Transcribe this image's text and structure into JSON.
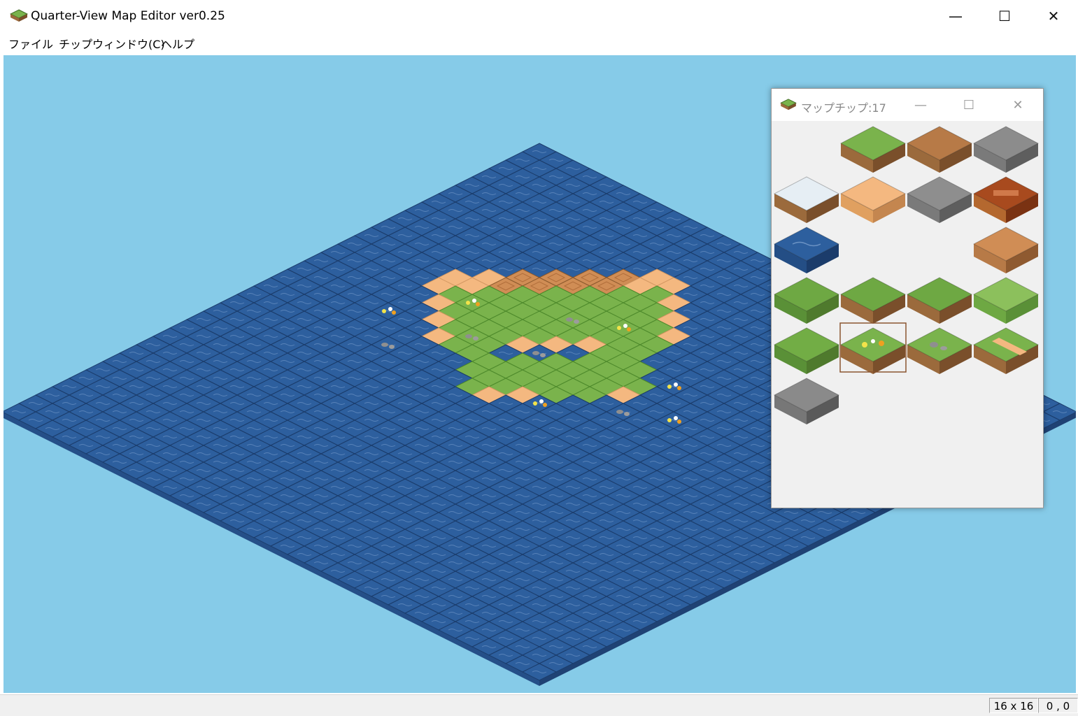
{
  "window": {
    "title": "Quarter-View Map Editor ver0.25",
    "minimize_glyph": "—",
    "maximize_glyph": "☐",
    "close_glyph": "✕"
  },
  "menu": {
    "items": [
      {
        "label": "ファイル"
      },
      {
        "label": "チップウィンドウ(C)"
      },
      {
        "label": "ヘルプ"
      }
    ]
  },
  "palette": {
    "title": "マップチップ:17",
    "minimize_glyph": "—",
    "maximize_glyph": "☐",
    "close_glyph": "✕",
    "chips": [
      null,
      "grass",
      "dirt",
      "stone-cobble",
      "snow",
      "sand",
      "stone-block",
      "wood-crate",
      "water",
      null,
      null,
      "dirt-cobble",
      "grass-slope-left",
      "grass-slope-down",
      "grass-slope-down-right",
      "grass-slope-right",
      "grass-plain",
      "grass-flowers",
      "grass-rocks",
      "grass-path",
      "stone-block-dark",
      null,
      null,
      null
    ],
    "selected_index": 17
  },
  "status": {
    "map_size": "16 x 16",
    "cursor": "0 , 0"
  },
  "colors": {
    "canvas_bg": "#86cbe8",
    "water_top": "#2d5f9e",
    "water_side": "#244e85",
    "grass": "#7ab34c",
    "sand": "#f4b880",
    "dirt": "#d08d55",
    "selection": "#8a5530"
  }
}
